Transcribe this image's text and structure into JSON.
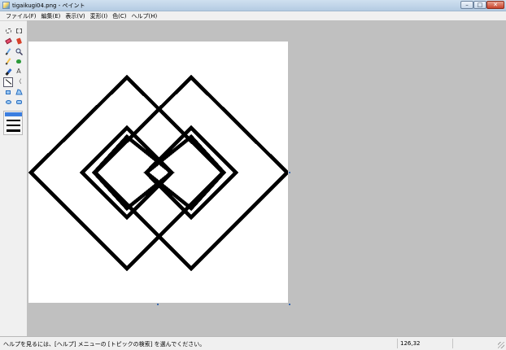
{
  "window": {
    "title": "tigaikugi04.png - ペイント",
    "minimize_glyph": "–",
    "maximize_glyph": "□",
    "close_glyph": "✕"
  },
  "menu": [
    {
      "label": "ファイル(F)"
    },
    {
      "label": "編集(E)"
    },
    {
      "label": "表示(V)"
    },
    {
      "label": "変形(I)"
    },
    {
      "label": "色(C)"
    },
    {
      "label": "ヘルプ(H)"
    }
  ],
  "tools": [
    {
      "name": "free-select-tool",
      "icon": "free-select-icon"
    },
    {
      "name": "select-tool",
      "icon": "rect-select-icon"
    },
    {
      "name": "eraser-tool",
      "icon": "eraser-icon"
    },
    {
      "name": "fill-tool",
      "icon": "fill-bucket-icon"
    },
    {
      "name": "pick-color-tool",
      "icon": "eyedropper-icon"
    },
    {
      "name": "magnifier-tool",
      "icon": "magnifier-icon"
    },
    {
      "name": "pencil-tool",
      "icon": "pencil-icon"
    },
    {
      "name": "brush-tool",
      "icon": "brush-icon"
    },
    {
      "name": "airbrush-tool",
      "icon": "airbrush-icon"
    },
    {
      "name": "text-tool",
      "icon": "text-icon",
      "glyph": "A"
    },
    {
      "name": "line-tool",
      "icon": "line-icon",
      "active": true
    },
    {
      "name": "curve-tool",
      "icon": "curve-icon",
      "glyph": "〈"
    },
    {
      "name": "rectangle-tool",
      "icon": "rectangle-icon"
    },
    {
      "name": "polygon-tool",
      "icon": "polygon-icon"
    },
    {
      "name": "ellipse-tool",
      "icon": "ellipse-icon"
    },
    {
      "name": "rounded-rect-tool",
      "icon": "rounded-rect-icon"
    }
  ],
  "line_widths": [
    1,
    2,
    3,
    4
  ],
  "selected_line_width": 1,
  "colors": {
    "foreground": "#000000",
    "background": "#ffffff",
    "palette_row1": [
      "#000000",
      "#808080",
      "#800000",
      "#808000",
      "#008000",
      "#008080",
      "#000080",
      "#800080",
      "#808040",
      "#004040",
      "#0080ff",
      "#004080",
      "#8000ff",
      "#804000"
    ],
    "palette_row2": [
      "#ffffff",
      "#c0c0c0",
      "#ff0000",
      "#ffff00",
      "#00ff00",
      "#00ffff",
      "#0000ff",
      "#ff00ff",
      "#ffff80",
      "#00ff80",
      "#80ffff",
      "#8080ff",
      "#ff0080",
      "#ff8040"
    ]
  },
  "status": {
    "help": "ヘルプを見るには、[ヘルプ] メニューの [トピックの検索] を選んでください。",
    "coords": "126,32"
  }
}
